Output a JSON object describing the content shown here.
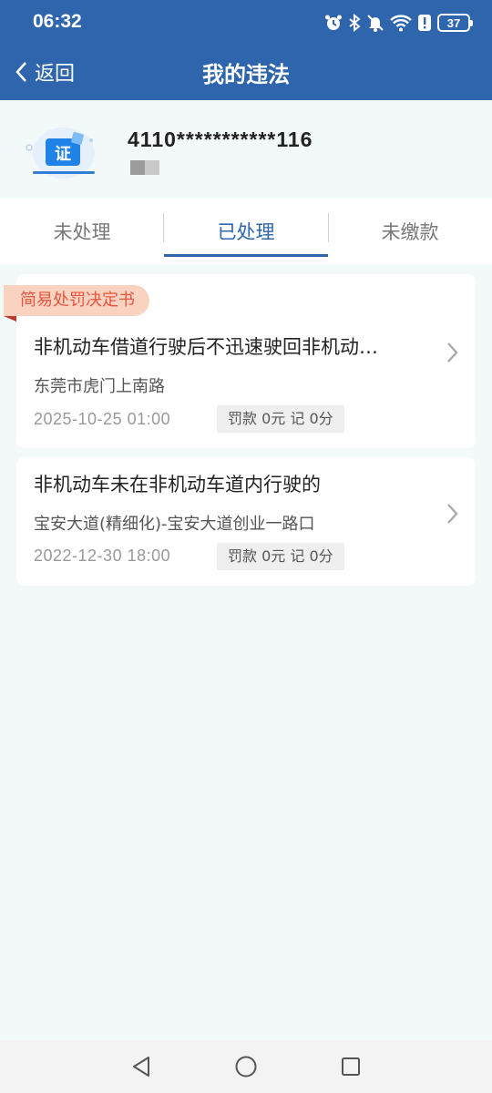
{
  "status_bar": {
    "time": "06:32",
    "battery": "37",
    "icons": [
      "alarm-icon",
      "bluetooth-icon",
      "mute-icon",
      "wifi-icon",
      "alert-icon",
      "battery-icon"
    ]
  },
  "header": {
    "back_label": "返回",
    "title": "我的违法",
    "color": "#2f65ad"
  },
  "profile": {
    "license_icon_text": "证",
    "plate_number": "4110***********116"
  },
  "tabs": [
    {
      "label": "未处理",
      "active": false
    },
    {
      "label": "已处理",
      "active": true
    },
    {
      "label": "未缴款",
      "active": false
    }
  ],
  "records": [
    {
      "tag": "简易处罚决定书",
      "title": "非机动车借道行驶后不迅速驶回非机动…",
      "location": "东莞市虎门上南路",
      "datetime": "2025-10-25 01:00",
      "penalty": "罚款 0元 记 0分"
    },
    {
      "title": "非机动车未在非机动车道内行驶的",
      "location": "宝安大道(精细化)-宝安大道创业一路口",
      "datetime": "2022-12-30 18:00",
      "penalty": "罚款 0元 记 0分"
    }
  ],
  "system_nav": [
    "back-triangle-icon",
    "home-circle-icon",
    "recents-square-icon"
  ]
}
